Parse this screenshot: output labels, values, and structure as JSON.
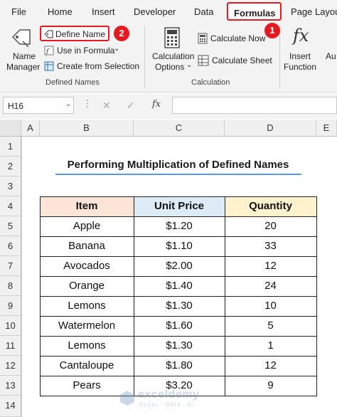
{
  "ribbon_tabs": {
    "file": "File",
    "home": "Home",
    "insert": "Insert",
    "developer": "Developer",
    "data": "Data",
    "formulas": "Formulas",
    "page_layout": "Page Layou"
  },
  "badges": {
    "one": "1",
    "two": "2"
  },
  "defined_names": {
    "name_manager_line1": "Name",
    "name_manager_line2": "Manager",
    "define_name": "Define Name",
    "use_in_formula": "Use in Formula",
    "create_from_selection": "Create from Selection",
    "group_label": "Defined Names"
  },
  "calculation": {
    "options_line1": "Calculation",
    "options_line2": "Options",
    "calculate_now": "Calculate Now",
    "calculate_sheet": "Calculate Sheet",
    "group_label": "Calculation"
  },
  "insert_function": {
    "line1": "Insert",
    "line2": "Function",
    "fx_glyph": "fx",
    "cut_label": "Au"
  },
  "formula_bar": {
    "name_box": "H16",
    "cancel": "✕",
    "enter": "✓",
    "fx": "fx"
  },
  "columns": [
    "A",
    "B",
    "C",
    "D",
    "E"
  ],
  "rows": [
    "1",
    "2",
    "3",
    "4",
    "5",
    "6",
    "7",
    "8",
    "9",
    "10",
    "11",
    "12",
    "13",
    "14"
  ],
  "sheet": {
    "title": "Performing Multiplication of Defined Names",
    "headers": [
      "Item",
      "Unit Price",
      "Quantity"
    ],
    "data": [
      [
        "Apple",
        "$1.20",
        "20"
      ],
      [
        "Banana",
        "$1.10",
        "33"
      ],
      [
        "Avocados",
        "$2.00",
        "12"
      ],
      [
        "Orange",
        "$1.40",
        "24"
      ],
      [
        "Lemons",
        "$1.30",
        "10"
      ],
      [
        "Watermelon",
        "$1.60",
        "5"
      ],
      [
        "Lemons",
        "$1.30",
        "1"
      ],
      [
        "Cantaloupe",
        "$1.80",
        "12"
      ],
      [
        "Pears",
        "$3.20",
        "9"
      ]
    ]
  },
  "watermark": {
    "brand": "exceldemy",
    "tagline": "EXCEL · DATA · BI"
  },
  "colors": {
    "accent_red": "#e8181f",
    "header_item": "#fce4d6",
    "header_price": "#ddebf7",
    "header_qty": "#fff2cc",
    "title_underline": "#5b9bd5"
  }
}
